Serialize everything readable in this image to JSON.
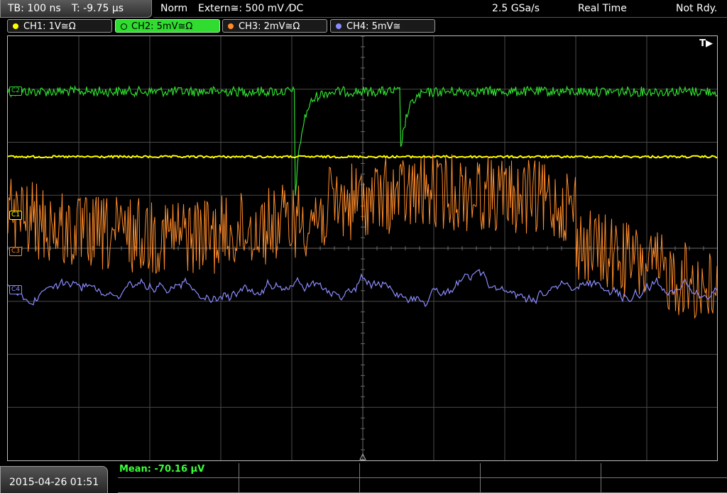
{
  "topbar": {
    "timebase": "TB: 100 ns",
    "trigger_time": "T: -9.75 µs",
    "trigger_mode": "Norm",
    "trigger_source": "Extern≅: 500 mV ⁄DC",
    "sample_rate": "2.5 GSa/s",
    "acq_mode": "Real Time",
    "status": "Not Rdy."
  },
  "channels": [
    {
      "label": "CH1: 1V≅Ω",
      "color": "#ffff00",
      "active": false
    },
    {
      "label": "CH2: 5mV≅Ω",
      "color": "#2fdc2f",
      "active": true
    },
    {
      "label": "CH3: 2mV≅Ω",
      "color": "#ff8c2a",
      "active": false
    },
    {
      "label": "CH4: 5mV≅",
      "color": "#8b8bff",
      "active": false
    }
  ],
  "screen": {
    "trigger_marker": "T▶",
    "ref_labels": {
      "c1": "C1",
      "c2": "C2",
      "c3": "C3",
      "c4": "C4"
    },
    "colors": {
      "ch1": "#ffff00",
      "ch2": "#2fdc2f",
      "ch3": "#ff8c2a",
      "ch4": "#8b8bff",
      "grid": "#4a4a4a"
    }
  },
  "bottom": {
    "datetime": "2015-04-26 01:51",
    "measurement": "Mean: -70.16 µV"
  }
}
